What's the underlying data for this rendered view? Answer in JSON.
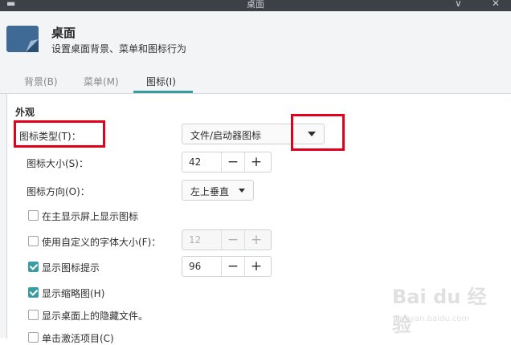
{
  "window": {
    "title": "桌面",
    "min_glyph": "∨",
    "close_glyph": "✕"
  },
  "header": {
    "title": "桌面",
    "subtitle": "设置桌面背景、菜单和图标行为",
    "icon": "desktop-icon"
  },
  "tabs": [
    {
      "label": "背景(B)",
      "active": false
    },
    {
      "label": "菜单(M)",
      "active": false
    },
    {
      "label": "图标(I)",
      "active": true
    }
  ],
  "appearance": {
    "section_label": "外观",
    "icon_type": {
      "label": "图标类型(T)：",
      "value": "文件/启动器图标"
    },
    "icon_size": {
      "label": "图标大小(S)：",
      "value": "42"
    },
    "icon_orientation": {
      "label": "图标方向(O)：",
      "value": "左上垂直"
    },
    "show_on_primary": {
      "label": "在主显示屏上显示图标",
      "checked": false
    },
    "custom_font_size": {
      "label": "使用自定义的字体大小(F)：",
      "checked": false,
      "value": "12"
    },
    "show_tooltips": {
      "label": "显示图标提示",
      "checked": true,
      "value": "96"
    },
    "show_thumbnails": {
      "label": "显示缩略图(H)",
      "checked": true
    },
    "show_hidden": {
      "label": "显示桌面上的隐藏文件。",
      "checked": false
    },
    "single_click": {
      "label": "单击激活项目(C)",
      "checked": false
    }
  },
  "spin_glyphs": {
    "minus": "−",
    "plus": "+"
  },
  "colors": {
    "accent": "#3a9ca3",
    "highlight": "#e3001b",
    "titlebar": "#3b4146"
  },
  "watermark": {
    "text": "Bai du 经验",
    "url": "jingyan.baidu.com"
  }
}
